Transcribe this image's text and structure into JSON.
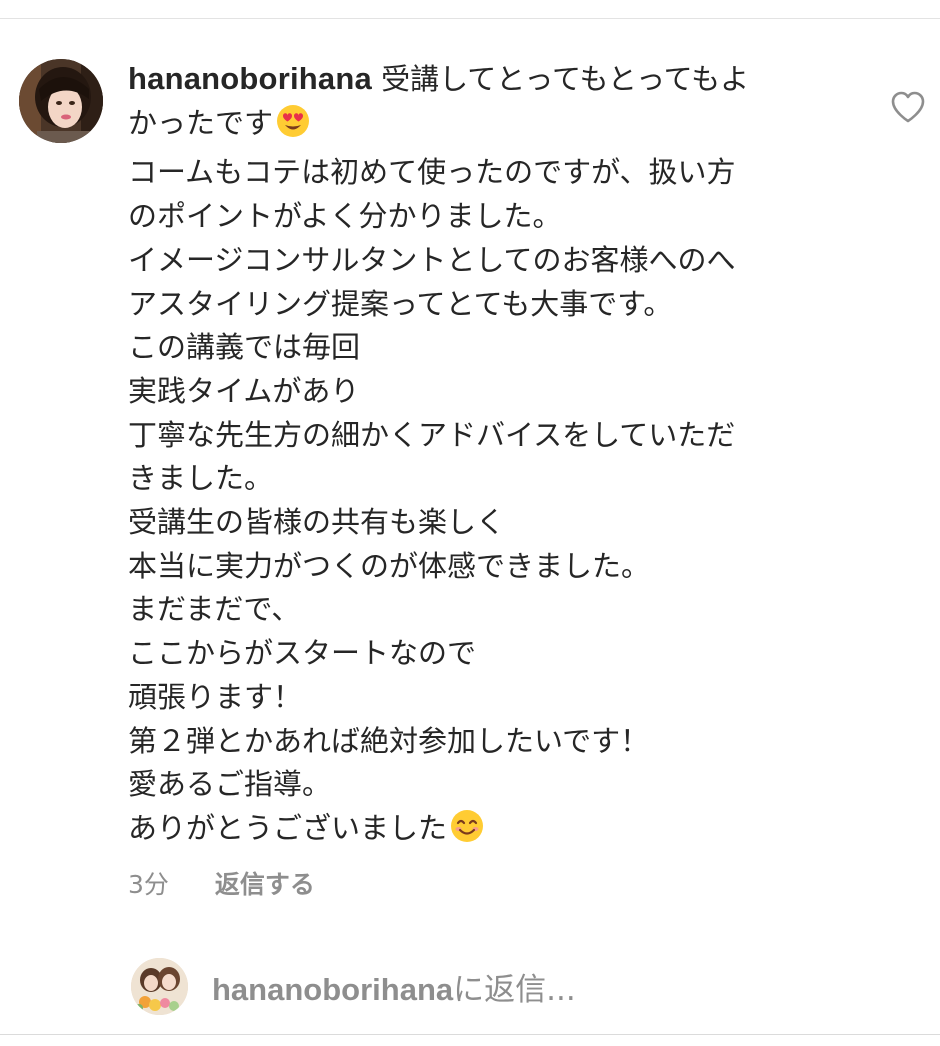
{
  "comment": {
    "username": "hananoborihana",
    "first_line": "受講してとってもとってもよ",
    "lines": [
      "かったです",
      "コームもコテは初めて使ったのですが、扱い方",
      "のポイントがよく分かりました。",
      "イメージコンサルタントとしてのお客様へのへ",
      "アスタイリング提案ってとても大事です。",
      "この講義では毎回",
      "実践タイムがあり",
      "丁寧な先生方の細かくアドバイスをしていただ",
      "きました。",
      "受講生の皆様の共有も楽しく",
      "本当に実力がつくのが体感できました。",
      "まだまだで、",
      "ここからがスタートなので",
      "頑張ります！",
      "第２弾とかあれば絶対参加したいです！",
      "愛あるご指導。",
      "ありがとうございました"
    ],
    "emoji_1": "heart-eyes-emoji",
    "emoji_2": "smiling-emoji",
    "time": "3分",
    "reply_label": "返信する"
  },
  "reply_box": {
    "username": "hananoborihana",
    "suffix": "に返信..."
  },
  "icons": {
    "like": "heart-outline-icon"
  },
  "colors": {
    "text": "#262626",
    "secondary": "#8e8e8e",
    "divider": "#dbdbdb",
    "emoji_face": "#ffcc33"
  }
}
